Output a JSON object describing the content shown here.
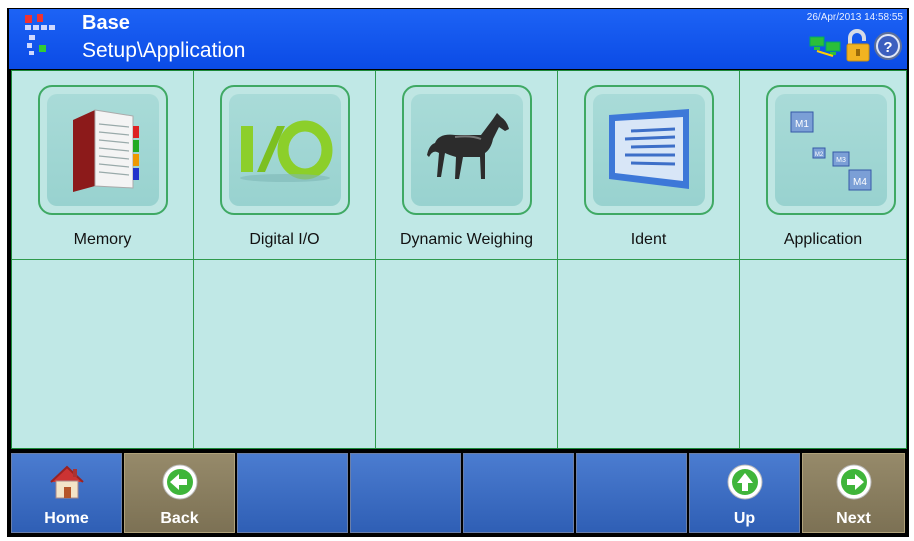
{
  "header": {
    "title": "Base",
    "subtitle": "Setup\\Application",
    "datetime": "26/Apr/2013 14:58:55",
    "icons": [
      "network-icon",
      "unlock-icon",
      "help-icon"
    ]
  },
  "grid": {
    "items": [
      {
        "label": "Memory",
        "icon": "memory-book-icon"
      },
      {
        "label": "Digital I/O",
        "icon": "io-icon"
      },
      {
        "label": "Dynamic Weighing",
        "icon": "horse-icon"
      },
      {
        "label": "Ident",
        "icon": "ident-screen-icon"
      },
      {
        "label": "Application",
        "icon": "application-m-icon"
      }
    ]
  },
  "footer": {
    "buttons": [
      {
        "label": "Home",
        "icon": "home-icon"
      },
      {
        "label": "Back",
        "icon": "left-arrow-icon"
      },
      {
        "label": "",
        "icon": ""
      },
      {
        "label": "",
        "icon": ""
      },
      {
        "label": "",
        "icon": ""
      },
      {
        "label": "",
        "icon": ""
      },
      {
        "label": "Up",
        "icon": "up-arrow-icon"
      },
      {
        "label": "Next",
        "icon": "right-arrow-icon"
      }
    ]
  },
  "colors": {
    "header": "#0b4be6",
    "grid_bg": "#c0e8e6",
    "grid_line": "#2f9a4d",
    "button_blue": "#3f6fc4",
    "button_tan": "#8b8060"
  }
}
